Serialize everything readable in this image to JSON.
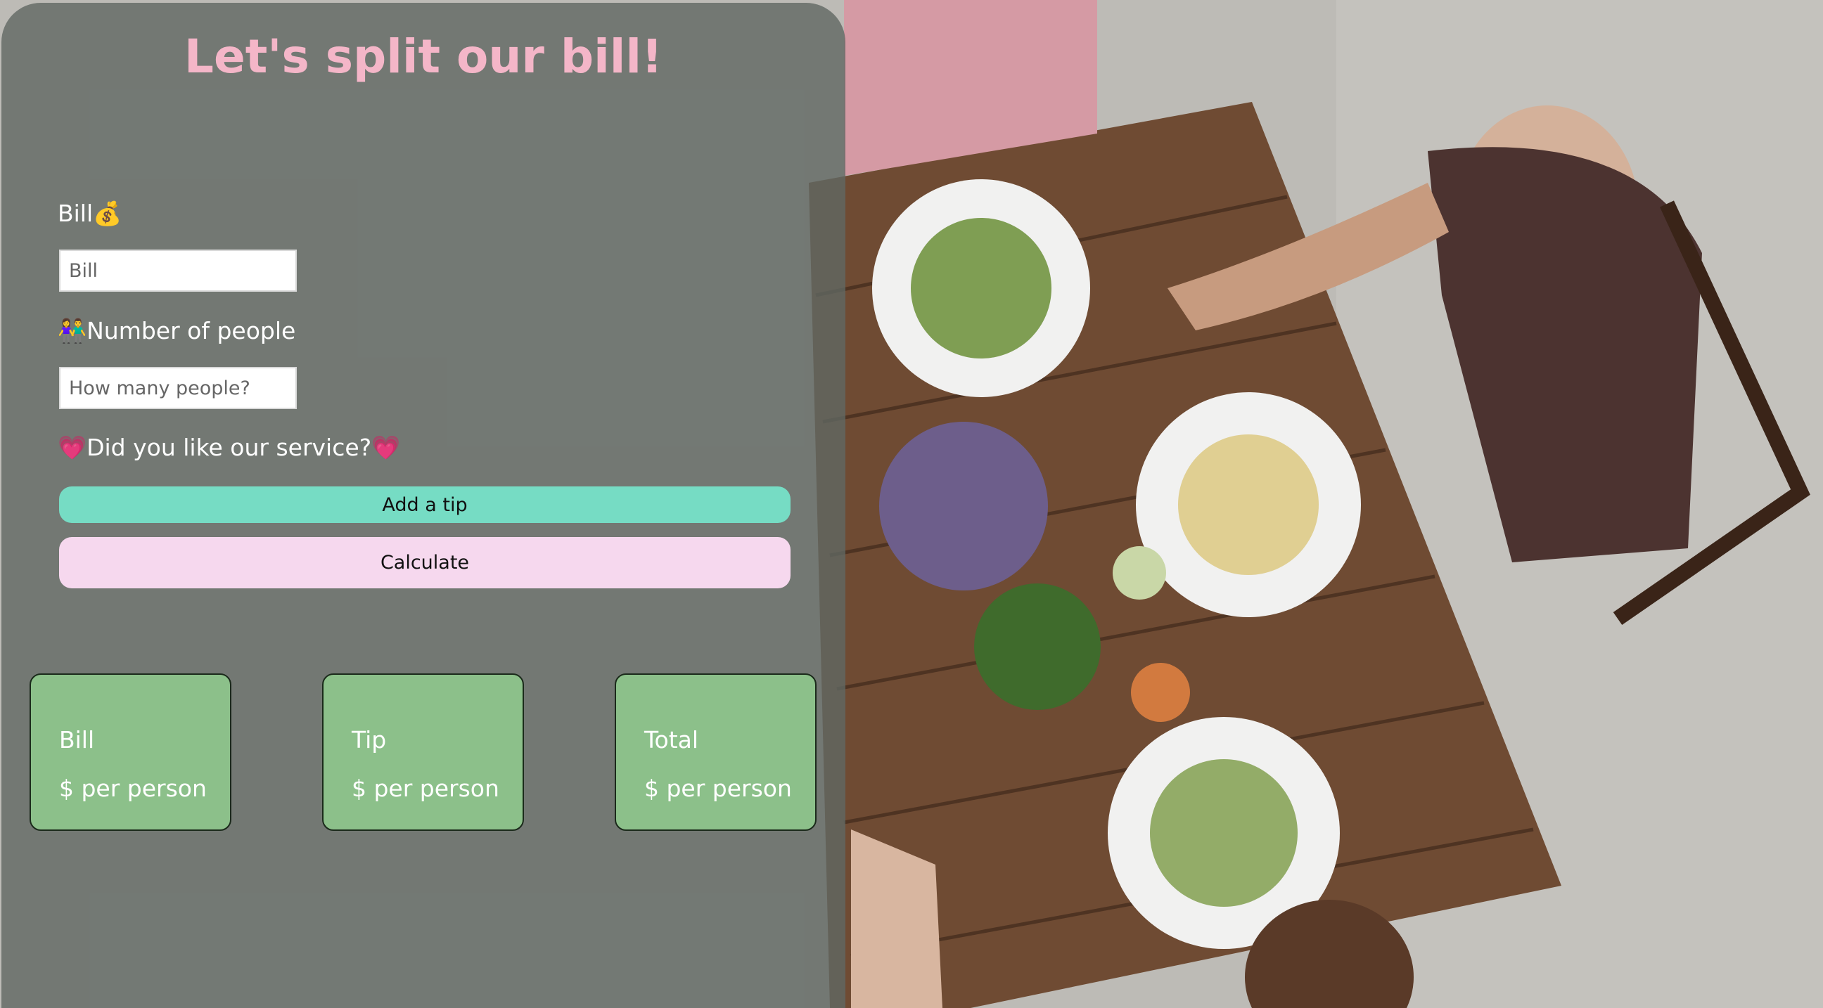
{
  "header": {
    "title": "Let's split our bill!"
  },
  "form": {
    "bill_label": "Bill💰",
    "bill_placeholder": "Bill",
    "people_label": "👫Number of people",
    "people_placeholder": "How many people?",
    "service_label": "💗Did you like our service?💗",
    "tip_button": "Add a tip",
    "calculate_button": "Calculate"
  },
  "results": [
    {
      "title": "Bill",
      "value": "$ per person"
    },
    {
      "title": "Tip",
      "value": "$ per person"
    },
    {
      "title": "Total",
      "value": "$ per person"
    }
  ],
  "colors": {
    "title": "#f4b6c8",
    "tip_button": "#76dcc4",
    "calculate_button": "#f6d8ee",
    "result_card": "#8cc08a"
  }
}
